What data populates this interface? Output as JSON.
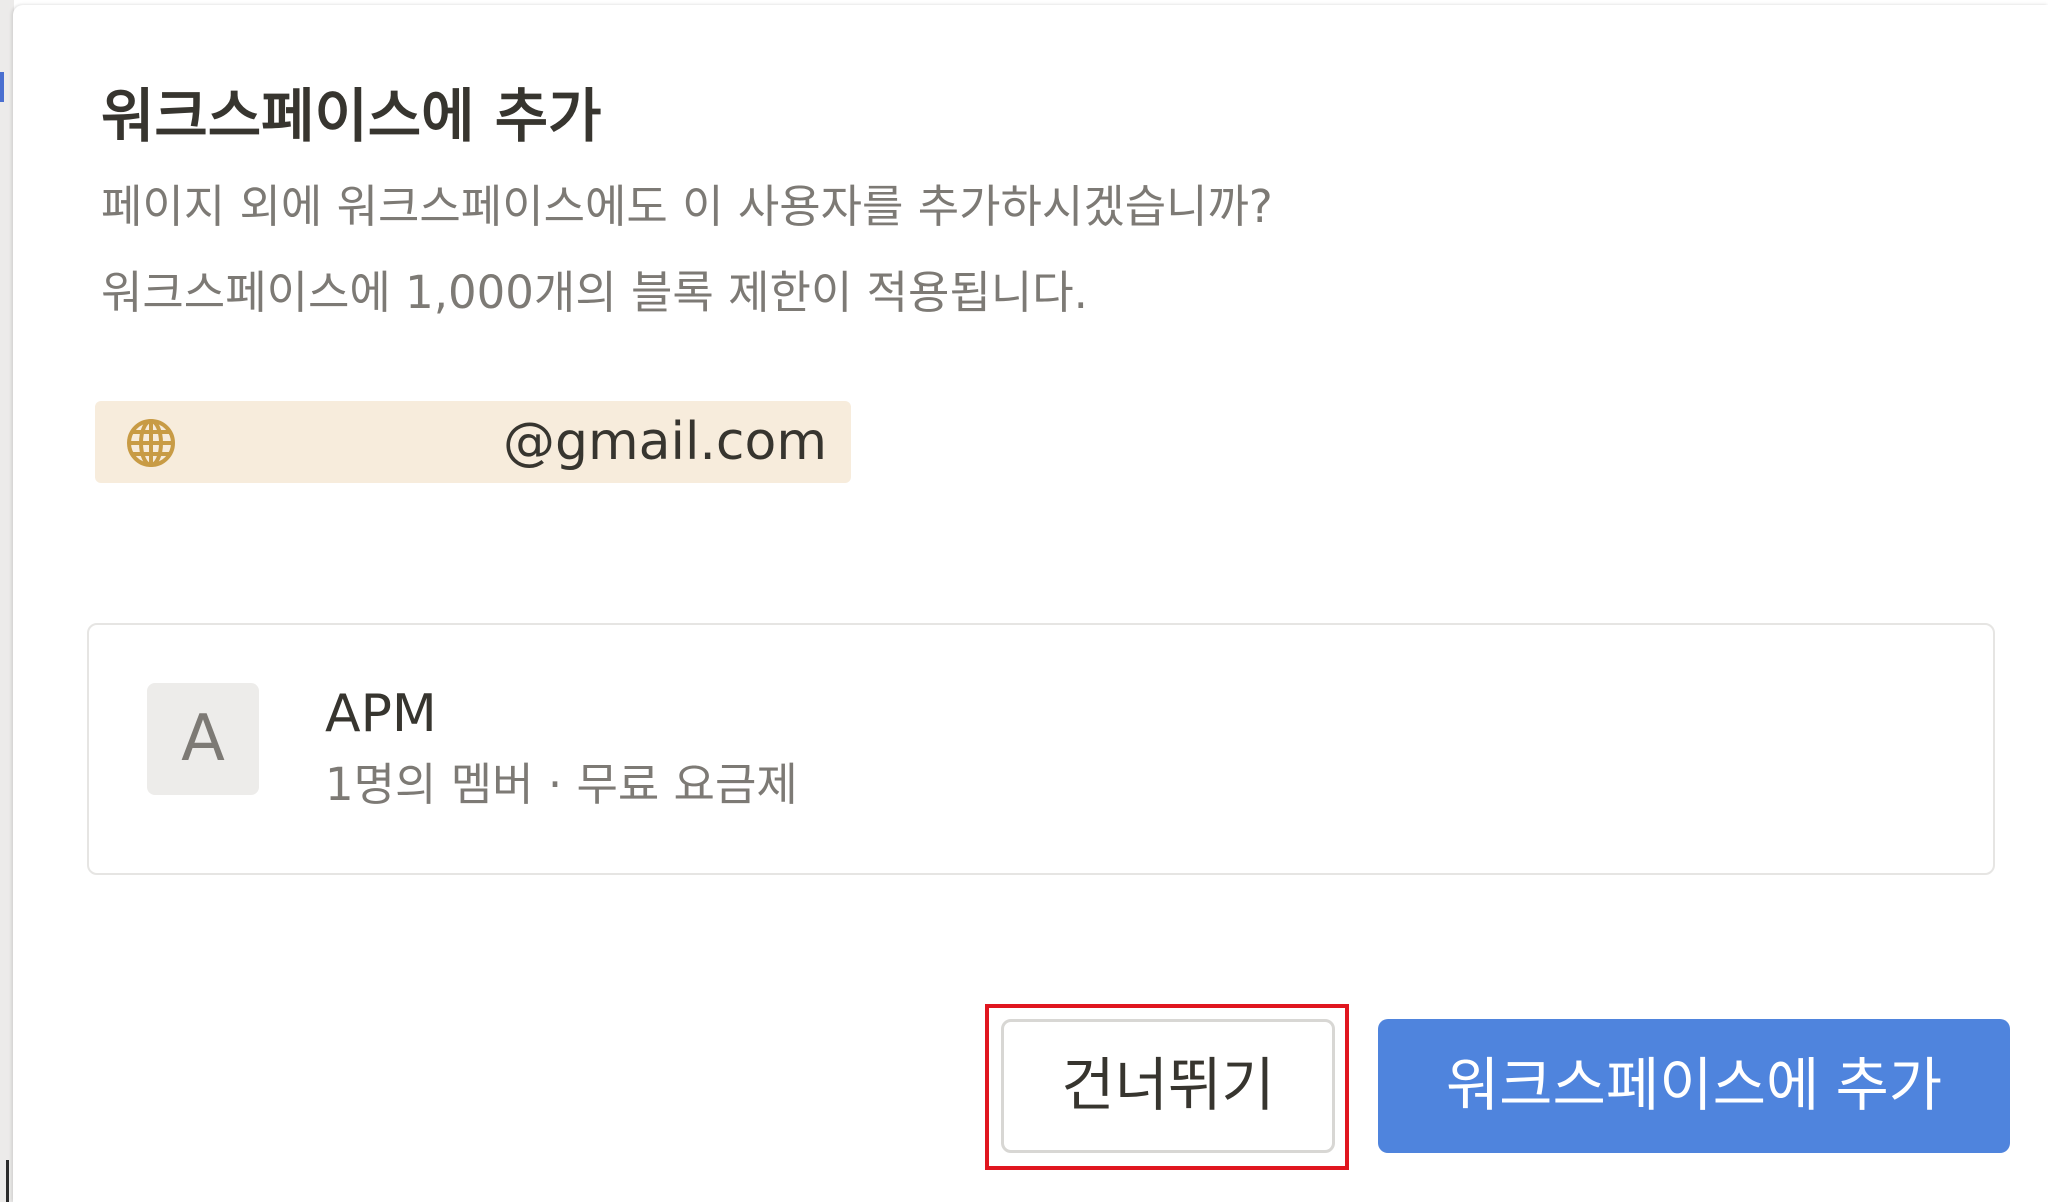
{
  "colors": {
    "accent": "#4f84dd",
    "highlight_box": "#e0161f",
    "email_chip_bg": "#f7ecdc",
    "globe_icon": "#c89b45"
  },
  "dialog": {
    "title": "워크스페이스에 추가",
    "description_1": "페이지 외에 워크스페이스에도 이 사용자를 추가하시겠습니까?",
    "description_2": "워크스페이스에 1,000개의 블록 제한이 적용됩니다."
  },
  "invitee": {
    "icon": "globe-icon",
    "email": "@gmail.com"
  },
  "workspace": {
    "avatar_letter": "A",
    "name": "APM",
    "meta": "1명의 멤버 · 무료 요금제"
  },
  "actions": {
    "skip_label": "건너뛰기",
    "add_label": "워크스페이스에 추가"
  }
}
